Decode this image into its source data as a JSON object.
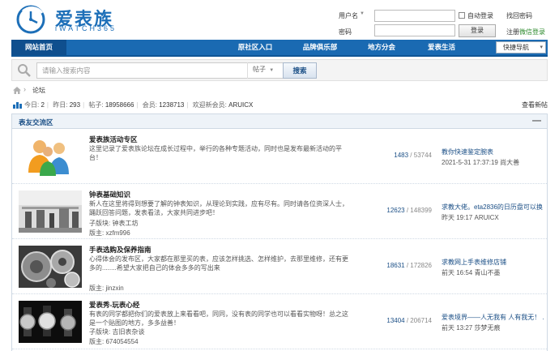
{
  "brand": {
    "name_cn": "爱表族",
    "name_en": "iWATCH365"
  },
  "login": {
    "username_label": "用户名",
    "password_label": "密码",
    "auto_login": "自动登录",
    "find_password": "找回密码",
    "login_button": "登录",
    "register": "注册",
    "wechat_login": "微信登录",
    "colors": {
      "wechat": "#2e8b2e"
    }
  },
  "nav": {
    "items": [
      "网站首页",
      "原社区入口",
      "品牌俱乐部",
      "地方分会",
      "爱表生活"
    ],
    "quick_nav": "快捷导航",
    "colors": {
      "bar": "#1a6ab2",
      "active": "#0f4f8e"
    }
  },
  "search": {
    "placeholder": "请输入搜索内容",
    "type": "帖子",
    "button": "搜索"
  },
  "breadcrumb": {
    "current": "论坛"
  },
  "stats": {
    "today_label": "今日:",
    "today": "2",
    "yesterday_label": "昨日:",
    "yesterday": "293",
    "posts_label": "帖子:",
    "posts": "18958666",
    "members_label": "会员:",
    "members": "1238713",
    "newest_label": "欢迎新会员:",
    "newest": "ARUICX",
    "new_posts_link": "查看新帖"
  },
  "section": {
    "title": "表友交流区",
    "collapse": "—",
    "forums": [
      {
        "title": "爱表族活动专区",
        "desc": "这里记录了爱表族论坛在成长过程中，举行的各种专题活动，同时也是发布最新活动的平台！",
        "subforums": "",
        "moderator": "",
        "threads": "1483",
        "posts": "53744",
        "last_title": "教你快速鉴定腕表",
        "last_time": "2021-5-31 17:37:19",
        "last_user": "尚大善",
        "thumb": "people-icon"
      },
      {
        "title": "钟表基础知识",
        "desc": "新人在这里将得到想要了解的钟表知识，从理论到实践，应有尽有。同时请各位资深人士，踊跃回答问题，发表看法，大家共同进步吧！",
        "subforums_label": "子版块:",
        "subforums": "钟表工坊",
        "moderator_label": "版主:",
        "moderator": "xzfm996",
        "threads": "12623",
        "posts": "148399",
        "last_title": "求教大佬。eta2836的日历盘可以换 ...",
        "last_time": "昨天 19:17",
        "last_user": "ARUICX",
        "thumb": "watch-workshop-photo"
      },
      {
        "title": "手表选购及保养指南",
        "desc": "心得体会的发布区，大家都在那里买的表，应该怎样挑选、怎样维护，去那里维修，还有更多的........希望大家把自己的体会多多的写出来",
        "subforums": "",
        "moderator_label": "版主:",
        "moderator": "jinzxin",
        "threads": "18631",
        "posts": "172826",
        "last_title": "求教网上手表维修店铺",
        "last_time": "前天 16:54",
        "last_user": "青山不墨",
        "thumb": "gears-photo"
      },
      {
        "title": "爱表秀-玩表心经",
        "desc": "有表的同学都把你们的爱表放上来看看吧，同同，没有表的同学也可以看看实物呀！总之这是一个贴图的地方，多多益善！",
        "subforums_label": "子版块:",
        "subforums": "吉旧表杂谈",
        "moderator_label": "版主:",
        "moderator": "674054554",
        "threads": "13404",
        "posts": "206714",
        "last_title": "爱表境界——人无我有 人有我无！ ...",
        "last_time": "前天 13:27",
        "last_user": "莎梦无痕",
        "thumb": "watches-photo"
      }
    ]
  }
}
